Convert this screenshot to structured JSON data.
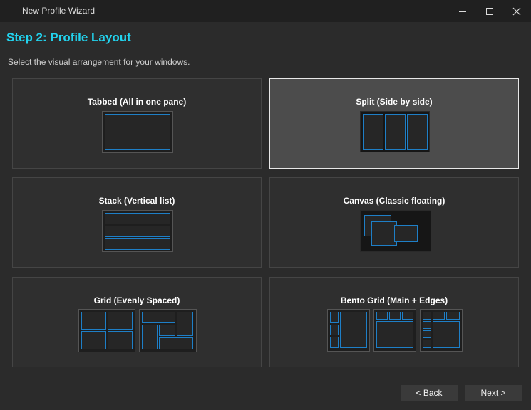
{
  "window": {
    "title": "New Profile Wizard",
    "controls": [
      "minimize",
      "maximize",
      "close"
    ]
  },
  "page": {
    "heading": "Step 2: Profile Layout",
    "subtitle": "Select the visual arrangement for your windows.",
    "accent_color": "#22d3ee",
    "pane_border_color": "#1e7fc7"
  },
  "layouts": [
    {
      "id": "tabbed",
      "label": "Tabbed (All in one pane)",
      "selected": false
    },
    {
      "id": "split",
      "label": "Split (Side by side)",
      "selected": true
    },
    {
      "id": "stack",
      "label": "Stack (Vertical list)",
      "selected": false
    },
    {
      "id": "canvas",
      "label": "Canvas (Classic floating)",
      "selected": false
    },
    {
      "id": "grid",
      "label": "Grid (Evenly Spaced)",
      "selected": false
    },
    {
      "id": "bento",
      "label": "Bento Grid (Main + Edges)",
      "selected": false
    }
  ],
  "footer": {
    "back_label": "< Back",
    "next_label": "Next >"
  }
}
